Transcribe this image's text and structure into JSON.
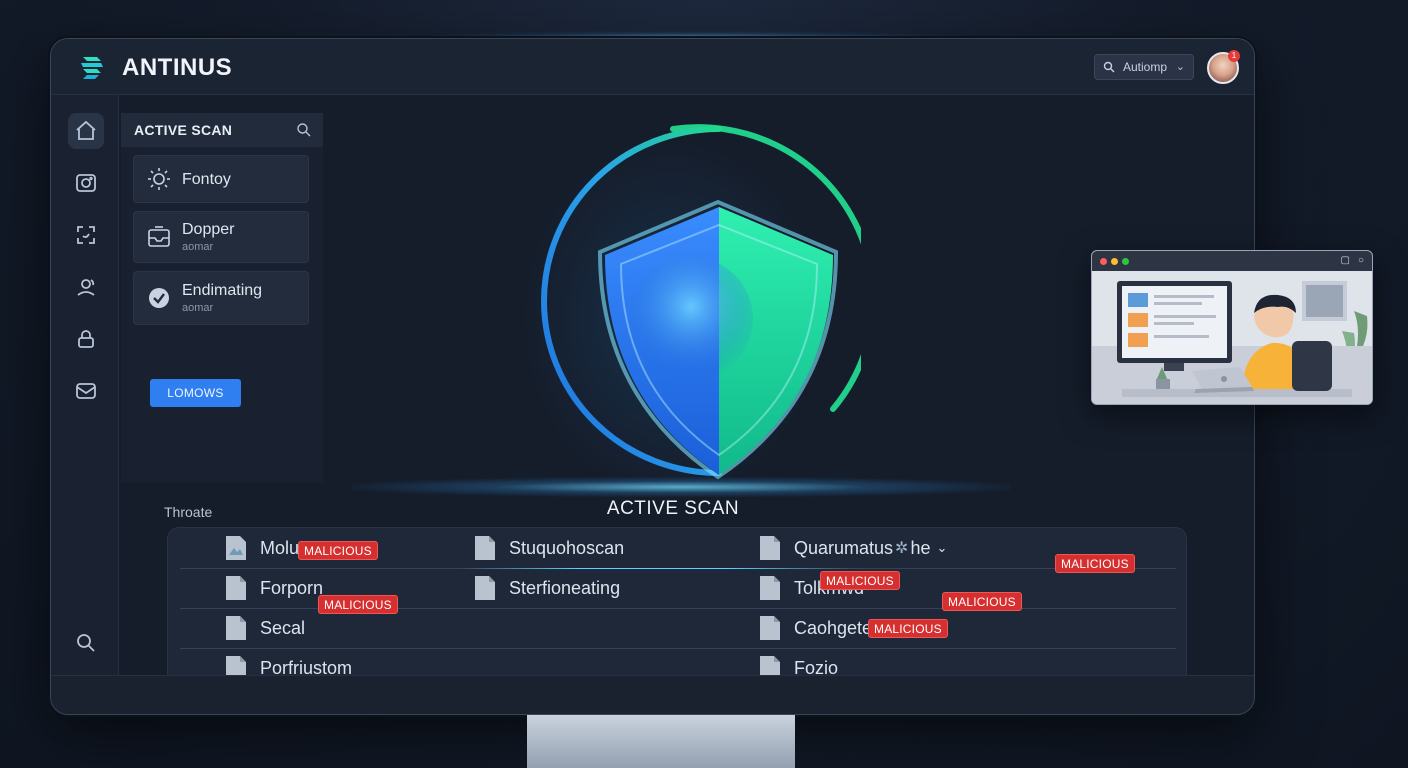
{
  "app": {
    "title": "ANTINUS"
  },
  "header": {
    "search_text": "Autiomp",
    "notification_count": "1"
  },
  "rail": {
    "items": [
      "home-icon",
      "camera-icon",
      "scan-icon",
      "user-refresh-icon",
      "lock-icon",
      "mail-icon",
      "search-icon"
    ]
  },
  "panel": {
    "title": "ACTIVE SCAN",
    "items": [
      {
        "title": "Fontoy",
        "sub": "",
        "icon": "sun-icon"
      },
      {
        "title": "Dopper",
        "sub": "aomar",
        "icon": "inbox-icon"
      },
      {
        "title": "Endimating",
        "sub": "aomar",
        "icon": "check-shield-icon"
      }
    ],
    "button_label": "LOMOWS"
  },
  "main": {
    "scan_label": "ACTIVE SCAN",
    "threats_label": "Throate",
    "files": {
      "col1": [
        "Molu",
        "Forporn",
        "Secal",
        "Porfriustom"
      ],
      "col2": [
        "Stuquohoscan",
        "Sterfioneating"
      ],
      "col3": [
        "Quarumatus",
        "Tolkmwd",
        "Caohgete",
        "Fozio"
      ]
    },
    "tag_label": "MALICIOUS",
    "col3_header_suffix": "he"
  },
  "colors": {
    "accent": "#2f7ff0",
    "shield_blue": "#2b7fe8",
    "shield_green": "#1fd89a",
    "danger": "#d62f2f"
  }
}
